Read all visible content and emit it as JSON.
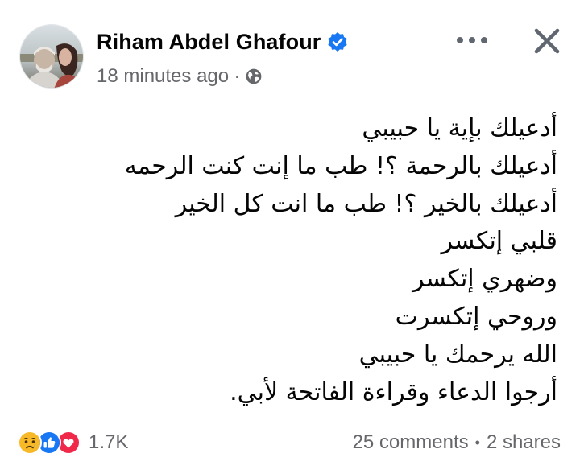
{
  "post": {
    "author": "Riham Abdel Ghafour",
    "verified": true,
    "timestamp": "18 minutes ago",
    "meta_separator": "·",
    "audience_icon": "globe-icon",
    "more_icon": "more-horizontal-icon",
    "close_icon": "close-icon",
    "body_lines": [
      "أدعيلك بإية يا حبيبي",
      "أدعيلك بالرحمة ؟! طب ما إنت كنت الرحمه",
      "أدعيلك بالخير ؟! طب ما انت كل الخير",
      "قلبي إتكسر",
      "وضهري إتكسر",
      "وروحي إتكسرت",
      "الله يرحمك يا حبيبي",
      "أرجوا الدعاء وقراءة الفاتحة  لأبي."
    ]
  },
  "footer": {
    "reactions": [
      "sad-icon",
      "like-icon",
      "love-icon"
    ],
    "reaction_count": "1.7K",
    "comments": "25 comments",
    "separator": "•",
    "shares": "2 shares"
  },
  "colors": {
    "text": "#050505",
    "secondary": "#65676b",
    "verified_blue": "#1877f2",
    "like_blue": "#1877f2",
    "love_red": "#f02849",
    "sad_yellow": "#f7b928"
  }
}
